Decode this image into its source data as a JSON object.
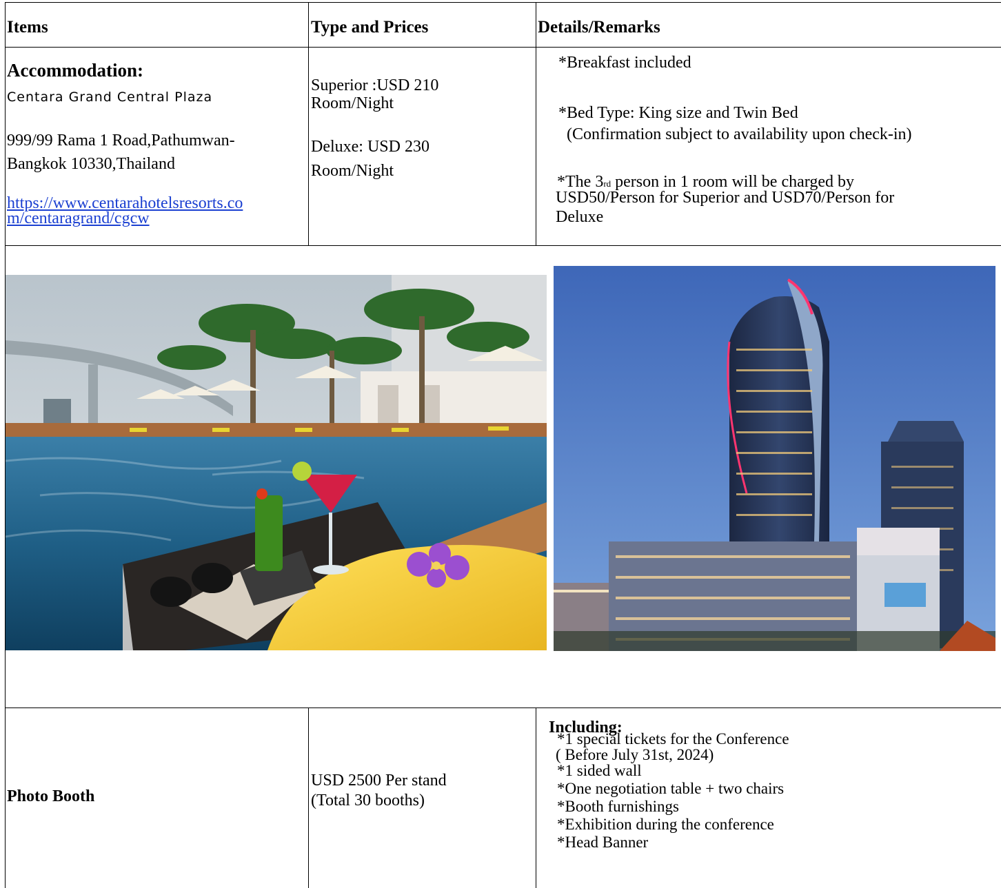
{
  "headers": {
    "items": "Items",
    "type_prices": "Type and Prices",
    "details": "Details/Remarks"
  },
  "accommodation": {
    "title": "Accommodation:",
    "hotel_name": "Centara Grand Central Plaza",
    "address_line1": "999/99 Rama 1 Road,Pathumwan-",
    "address_line2": "Bangkok 10330,Thailand",
    "url_line1": "https://www.centarahotelsresorts.co",
    "url_line2": "m/centaragrand/cgcw",
    "superior_line1": "Superior :USD 210",
    "superior_line2": "Room/Night",
    "deluxe_line1": "Deluxe:  USD 230",
    "deluxe_line2": "Room/Night",
    "remark_breakfast": "*Breakfast included",
    "remark_bed_line1": "*Bed Type: King size  and Twin Bed",
    "remark_bed_line2": "(Confirmation subject to availability upon check-in)",
    "remark_third_a": "*The 3",
    "remark_third_sup": "rd",
    "remark_third_b": " person in  1 room will be charged by",
    "remark_third_line2": "USD50/Person for Superior and USD70/Person for",
    "remark_third_line3": "Deluxe"
  },
  "photos": {
    "pool_icon": "rooftop-pool-photo",
    "tower_icon": "hotel-tower-photo"
  },
  "photo_booth": {
    "item": "Photo Booth",
    "price_line1": "USD 2500 Per stand",
    "price_line2": "(Total 30 booths)",
    "including": "Including:",
    "line1": "*1 special tickets for the Conference",
    "line2": "( Before July 31st, 2024)",
    "line3": "*1 sided wall",
    "line4": "*One negotiation table + two chairs",
    "line5": "*Booth furnishings",
    "line6": "*Exhibition during the conference",
    "line7": "*Head Banner"
  }
}
